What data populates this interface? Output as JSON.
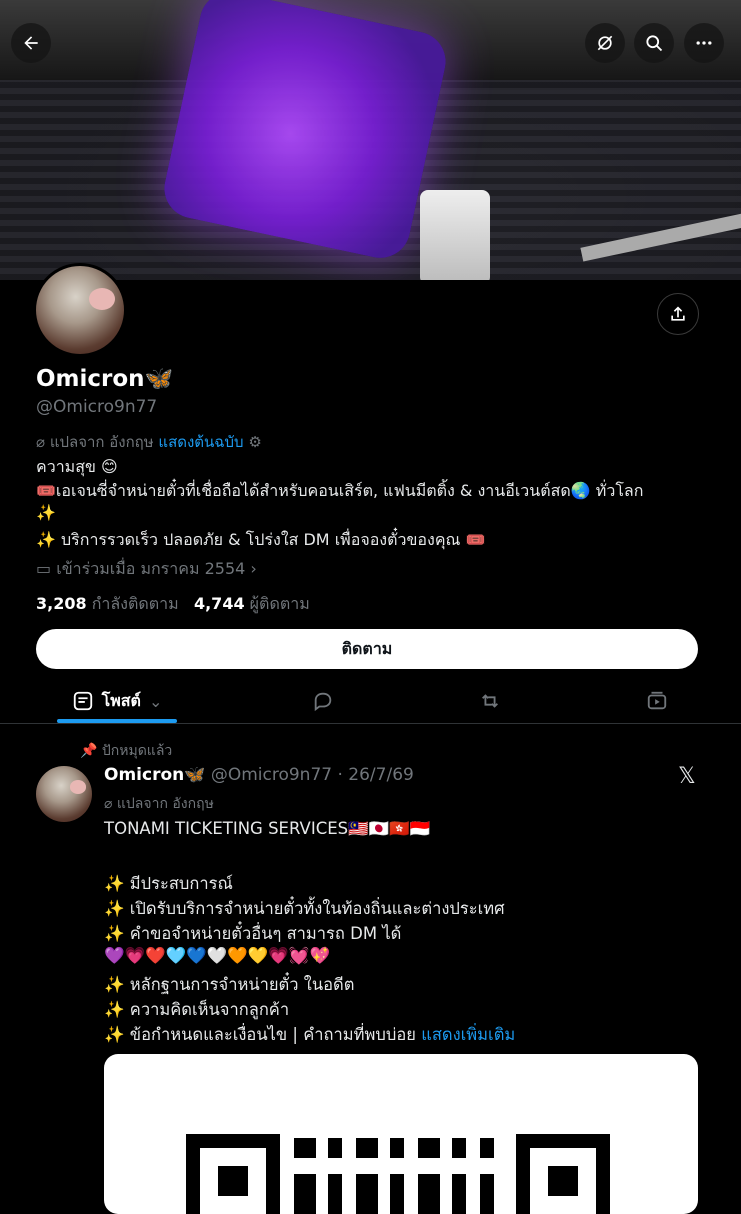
{
  "profile": {
    "name": "Omicron",
    "name_emoji": "🦋",
    "handle": "@Omicro9n77",
    "translated_from": "แปลจาก อังกฤษ",
    "show_original": "แสดงต้นฉบับ",
    "bio_line1": "ความสุข 😊",
    "bio_line2": "🎟️เอเจนซี่จำหน่ายตั๋วที่เชื่อถือได้สำหรับคอนเสิร์ต, แฟนมีตติ้ง & งานอีเวนต์สด🌏 ทั่วโลก",
    "bio_line3": "✨",
    "bio_line4": "✨ บริการรวดเร็ว ปลอดภัย & โปร่งใส DM เพื่อจองตั๋วของคุณ 🎟️",
    "joined": "เข้าร่วมเมื่อ มกราคม 2554",
    "following_count": "3,208",
    "following_label": "กำลังติดตาม",
    "followers_count": "4,744",
    "followers_label": "ผู้ติดตาม",
    "follow_button": "ติดตาม"
  },
  "tabs": {
    "posts_label": "โพสต์"
  },
  "post": {
    "pinned_label": "ปักหมุดแล้ว",
    "author_name": "Omicron",
    "author_emoji": "🦋",
    "author_handle": "@Omicro9n77",
    "date": "· 26/7/69",
    "translated_from": "แปลจาก อังกฤษ",
    "lines": [
      "TONAMI TICKETING SERVICES🇲🇾🇯🇵🇭🇰🇮🇩",
      "",
      "✨ มีประสบการณ์",
      "✨ เปิดรับบริการจำหน่ายตั๋วทั้งในท้องถิ่นและต่างประเทศ",
      "✨ คำขอจำหน่ายตั๋วอื่นๆ สามารถ DM ได้",
      "💜💗❤️🩵💙🤍🧡💛💗💓💖",
      "✨ หลักฐานการจำหน่ายตั๋ว ในอดีต",
      "✨ ความคิดเห็นจากลูกค้า",
      "✨ ข้อกำหนดและเงื่อนไข | คำถามที่พบบ่อย"
    ],
    "show_more": "แสดงเพิ่มเติม"
  },
  "colors": {
    "accent": "#1d9bf0",
    "muted": "#71767b",
    "background": "#000000"
  }
}
